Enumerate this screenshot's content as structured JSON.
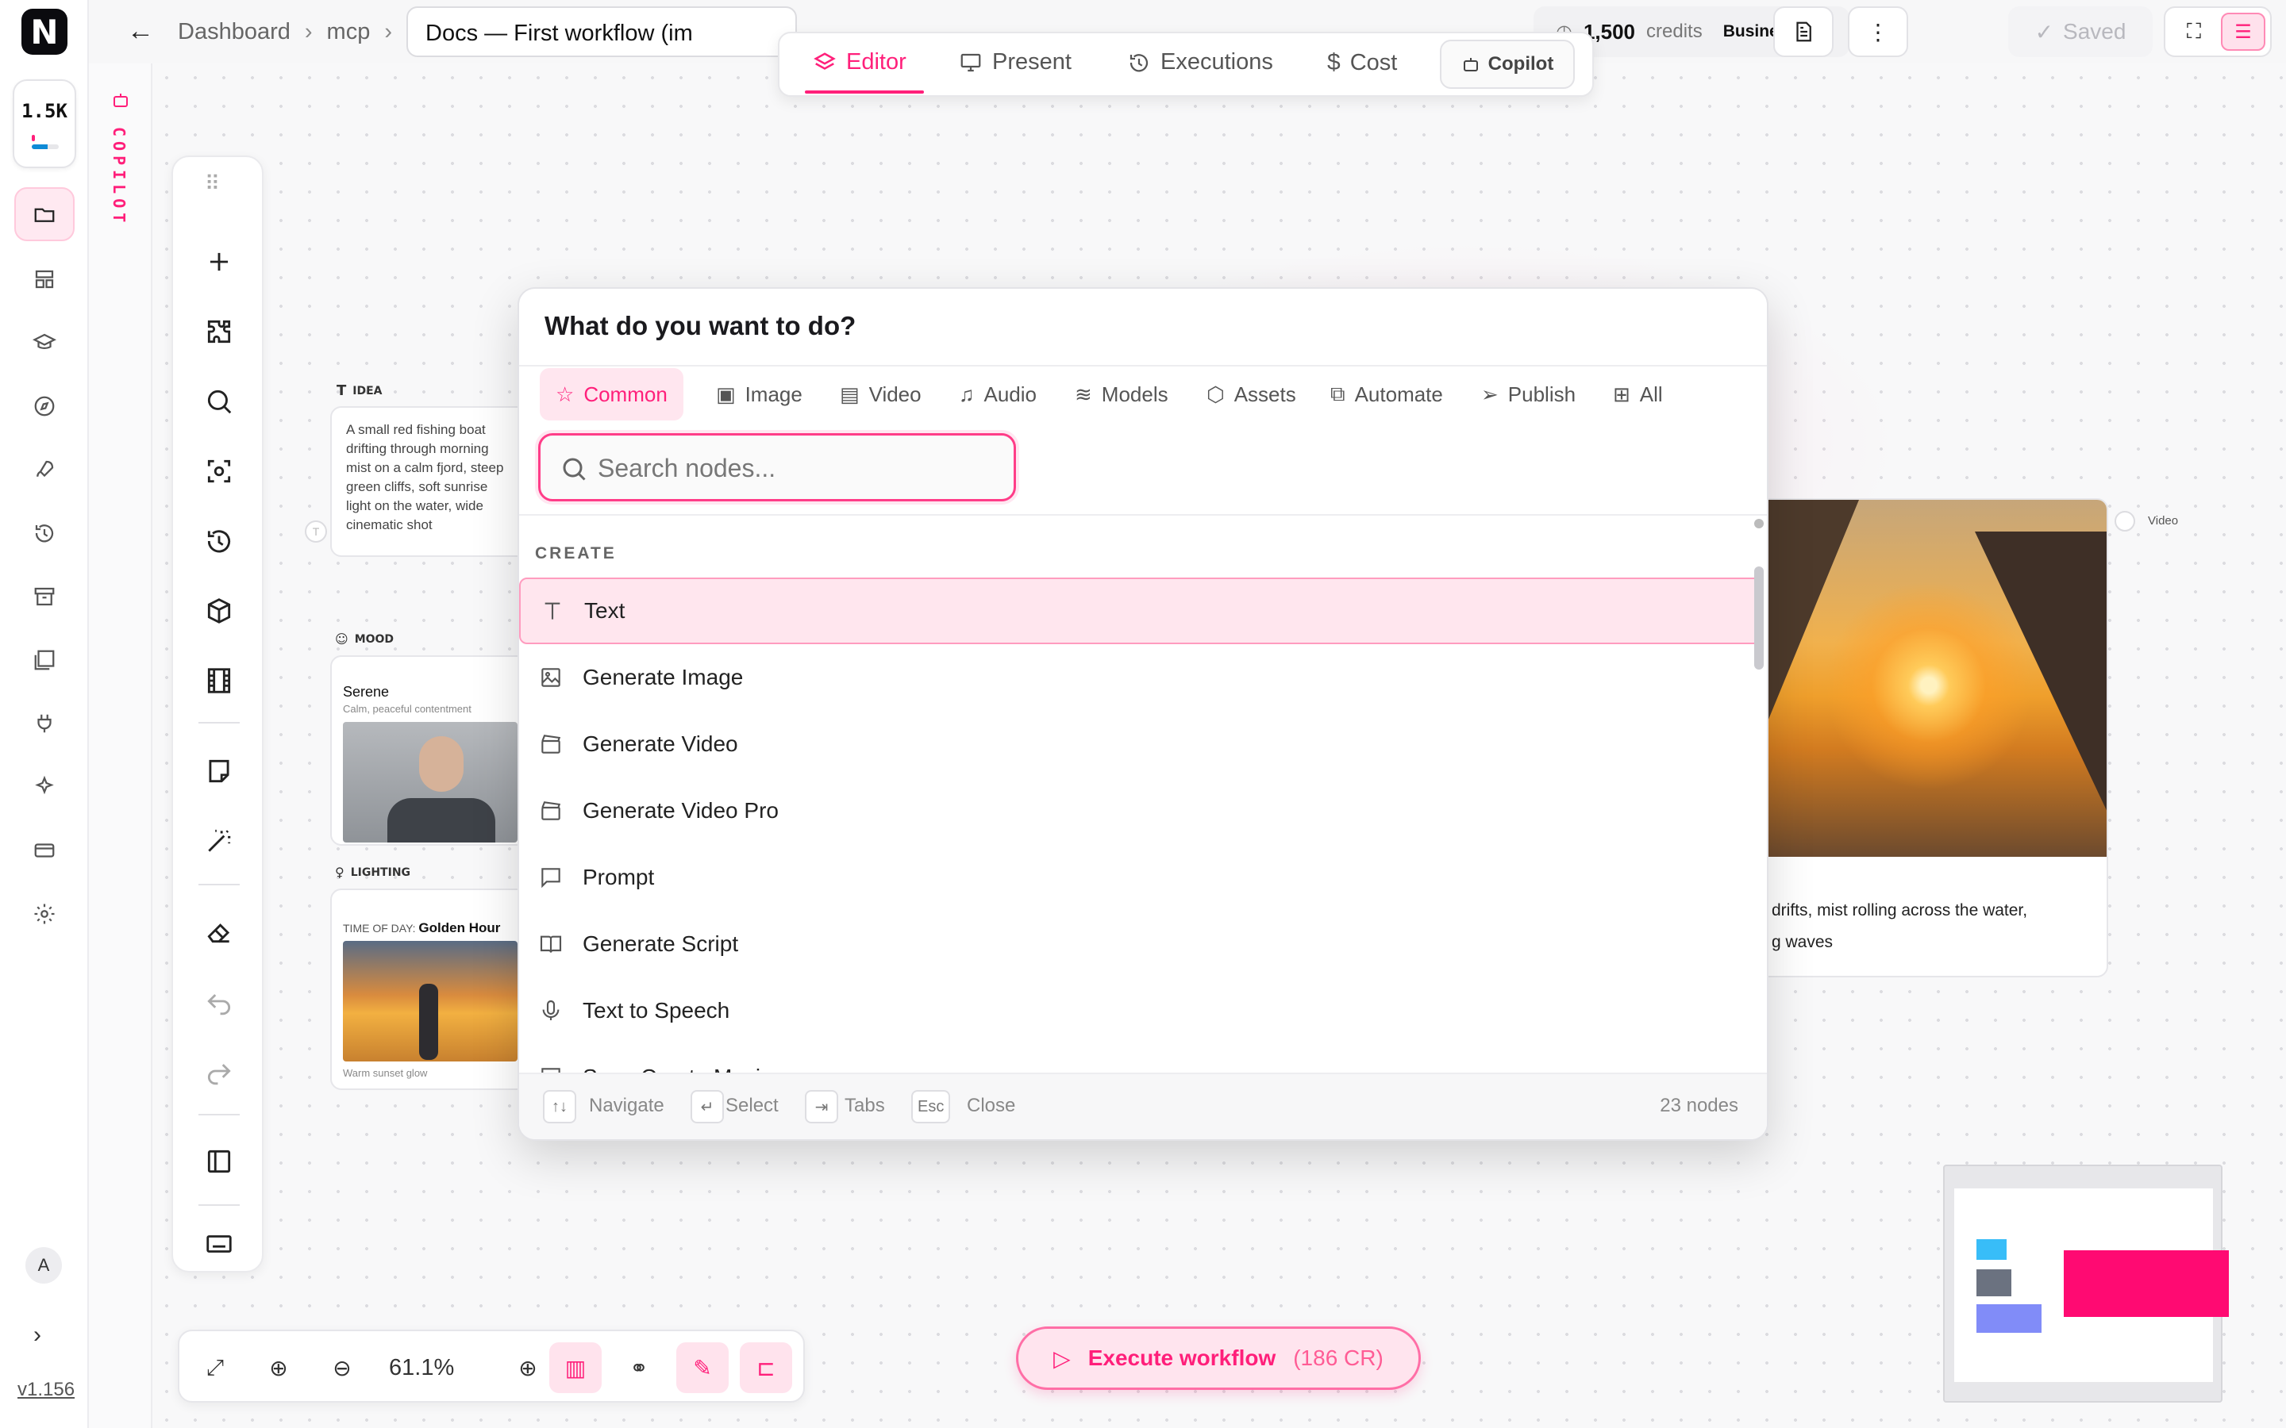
{
  "app": {
    "logo_letter": "N",
    "credit_short": "1.5K",
    "credit_fraction": 0.6,
    "version": "v1.156",
    "avatar_initial": "A",
    "brand_color": "#ff1f7a"
  },
  "copilot_rail": {
    "label": "COPILOT"
  },
  "topbar": {
    "breadcrumbs": [
      "Dashboard",
      "mcp"
    ],
    "document_title": "Docs — First workflow (im",
    "credits_amount": "1,500",
    "credits_label": "credits",
    "plan": "Business",
    "saved_label": "Saved"
  },
  "mode_tabs": [
    {
      "label": "Editor",
      "icon": "layers-icon",
      "active": true
    },
    {
      "label": "Present",
      "icon": "monitor-icon",
      "active": false
    },
    {
      "label": "Executions",
      "icon": "history-icon",
      "active": false
    },
    {
      "label": "Cost",
      "icon": "dollar-icon",
      "active": false
    }
  ],
  "copilot_tab": "Copilot",
  "toolbar_tools": [
    "grip-icon",
    "plus-icon",
    "puzzle-icon",
    "search-icon",
    "focus-icon",
    "history-icon",
    "box-icon",
    "film-icon",
    "note-icon",
    "magic-wand-icon",
    "eraser-icon",
    "undo-icon",
    "redo-icon",
    "panel-icon",
    "keyboard-icon"
  ],
  "canvas_nodes": {
    "idea": {
      "label": "IDEA",
      "text": "A small red fishing boat drifting through morning mist on a calm fjord, steep green cliffs, soft sunrise light on the water, wide cinematic shot"
    },
    "mood": {
      "label": "MOOD",
      "title": "Serene",
      "subtitle": "Calm, peaceful contentment"
    },
    "lighting": {
      "label": "LIGHTING",
      "time_label": "TIME OF DAY:",
      "time_value": "Golden Hour",
      "caption": "Warm sunset glow"
    },
    "video": {
      "label": "Video",
      "text_line1": "drifts, mist rolling across the water,",
      "text_line2": "g waves"
    }
  },
  "dialog": {
    "title": "What do you want to do?",
    "categories": [
      {
        "label": "Common",
        "icon": "star-icon",
        "active": true
      },
      {
        "label": "Image",
        "icon": "image-icon",
        "active": false
      },
      {
        "label": "Video",
        "icon": "film-icon",
        "active": false
      },
      {
        "label": "Audio",
        "icon": "music-icon",
        "active": false
      },
      {
        "label": "Models",
        "icon": "layers-icon",
        "active": false
      },
      {
        "label": "Assets",
        "icon": "box-icon",
        "active": false
      },
      {
        "label": "Automate",
        "icon": "workflow-icon",
        "active": false
      },
      {
        "label": "Publish",
        "icon": "send-icon",
        "active": false
      },
      {
        "label": "All",
        "icon": "grid-icon",
        "active": false
      }
    ],
    "search_placeholder": "Search nodes...",
    "section": "CREATE",
    "items": [
      {
        "label": "Text",
        "icon": "text-icon",
        "selected": true
      },
      {
        "label": "Generate Image",
        "icon": "image-icon",
        "selected": false
      },
      {
        "label": "Generate Video",
        "icon": "clapper-icon",
        "selected": false
      },
      {
        "label": "Generate Video Pro",
        "icon": "clapper-icon",
        "selected": false
      },
      {
        "label": "Prompt",
        "icon": "message-icon",
        "selected": false
      },
      {
        "label": "Generate Script",
        "icon": "book-icon",
        "selected": false
      },
      {
        "label": "Text to Speech",
        "icon": "mic-icon",
        "selected": false
      },
      {
        "label": "Suno Create Music",
        "icon": "music-icon",
        "selected": false
      }
    ],
    "footer": {
      "navigate_key": "↑↓",
      "navigate_label": "Navigate",
      "select_key": "↵",
      "select_label": "Select",
      "tabs_key": "⇥",
      "tabs_label": "Tabs",
      "close_key": "Esc",
      "close_label": "Close",
      "count": "23 nodes"
    }
  },
  "bottom_bar": {
    "zoom": "61.1%"
  },
  "execute": {
    "label": "Execute workflow",
    "cost": "(186 CR)"
  },
  "minimap": {
    "colors": [
      "#38bdf8",
      "#6b7280",
      "#818cf8",
      "#ff0a72"
    ]
  }
}
